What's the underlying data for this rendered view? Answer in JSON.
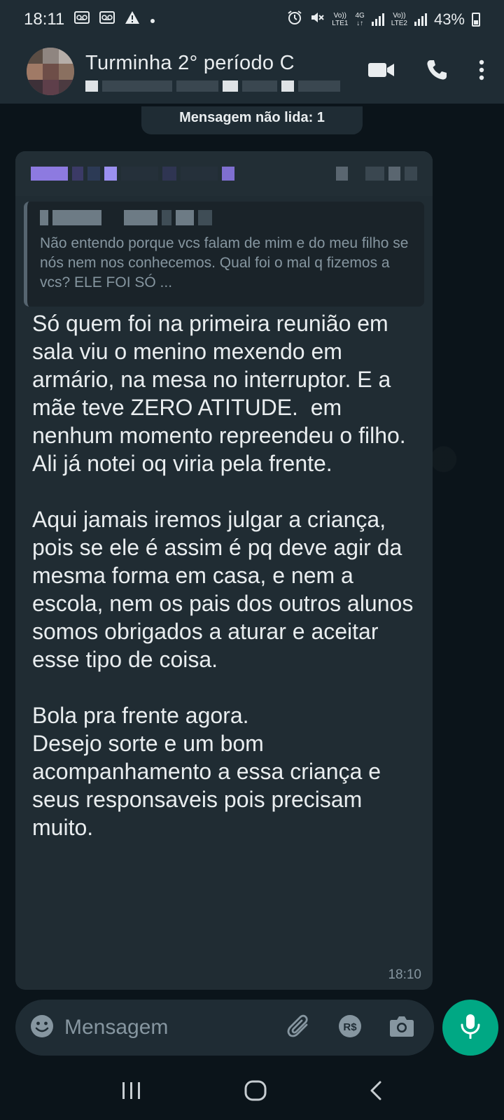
{
  "status_bar": {
    "time": "18:11",
    "battery": "43%",
    "net1_top": "Vo))",
    "net1_bottom": "LTE1",
    "net_type": "4G",
    "net2_top": "Vo))",
    "net2_bottom": "LTE2"
  },
  "header": {
    "title": "Turminha 2° período C"
  },
  "chat": {
    "unread_banner": "Mensagem não lida: 1",
    "message": {
      "quote_text": "Não entendo porque vcs falam de mim e do meu filho se nós nem nos conhecemos. Qual foi o mal q fizemos a vcs? ELE FOI SÓ ...",
      "body": "Só quem foi na primeira reunião em sala viu o menino mexendo em armário, na mesa no interruptor. E a mãe teve ZERO ATITUDE.  em nenhum momento repreendeu o filho. Ali já notei oq viria pela frente.\n\nAqui jamais iremos julgar a criança, pois se ele é assim é pq deve agir da mesma forma em casa, e nem a escola, nem os pais dos outros alunos somos obrigados a aturar e aceitar esse tipo de coisa.\n\nBola pra frente agora.\nDesejo sorte e um bom acompanhamento a essa criança e seus responsaveis pois precisam muito.",
      "time": "18:10"
    }
  },
  "input": {
    "placeholder": "Mensagem",
    "payment_label": "R$"
  },
  "colors": {
    "background": "#0b141a",
    "bar": "#1f2c34",
    "bubble": "#202c33",
    "accent": "#00a884",
    "secondary_text": "#8696a0"
  }
}
